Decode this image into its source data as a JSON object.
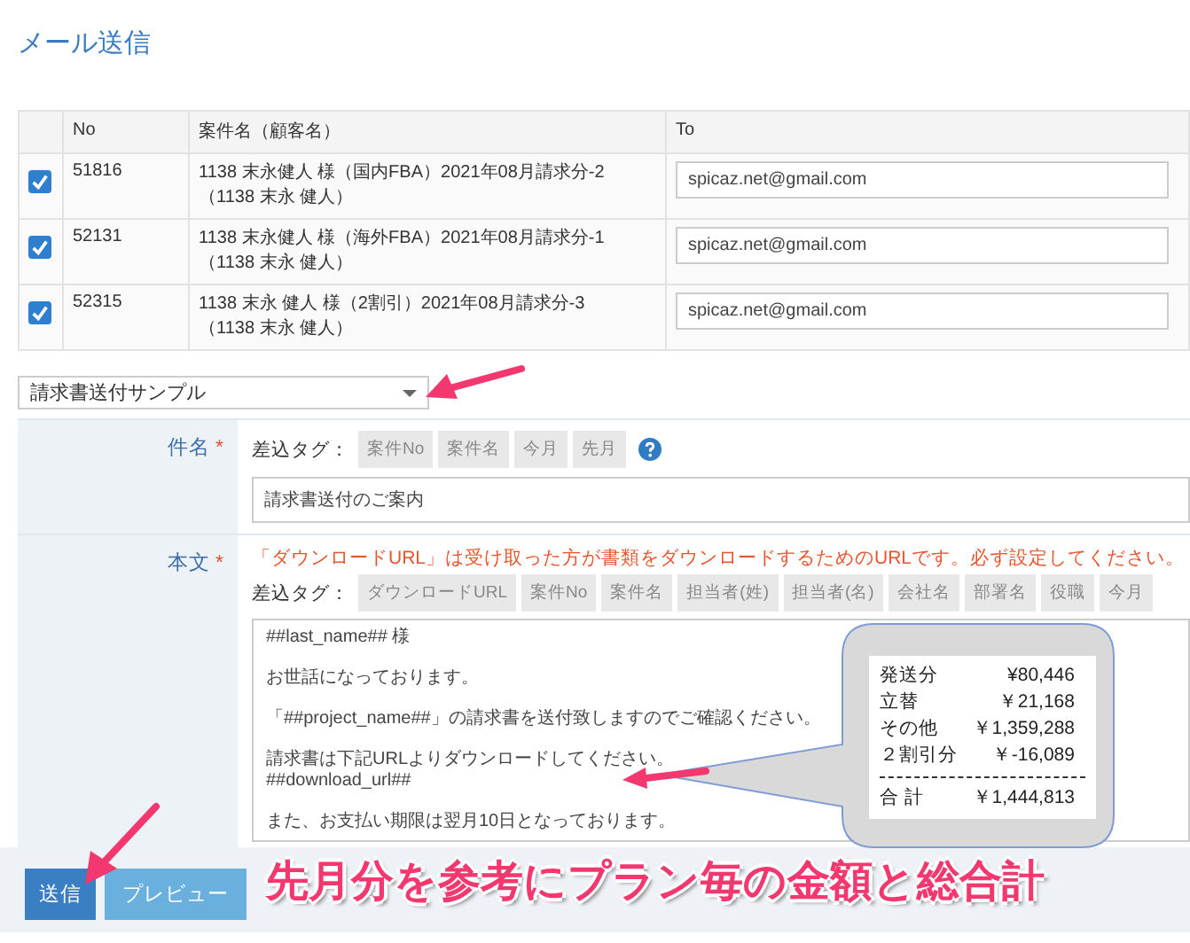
{
  "title": "メール送信",
  "table": {
    "columns": [
      "No",
      "案件名（顧客名）",
      "To"
    ],
    "rows": [
      {
        "checked": true,
        "no": "51816",
        "name": "1138 末永健人 様（国内FBA）2021年08月請求分-2",
        "customer": "（1138 末永 健人）",
        "to": "spicaz.net@gmail.com"
      },
      {
        "checked": true,
        "no": "52131",
        "name": "1138 末永健人 様（海外FBA）2021年08月請求分-1",
        "customer": "（1138 末永 健人）",
        "to": "spicaz.net@gmail.com"
      },
      {
        "checked": true,
        "no": "52315",
        "name": "1138 末永 健人 様（2割引）2021年08月請求分-3",
        "customer": "（1138 末永 健人）",
        "to": "spicaz.net@gmail.com"
      }
    ]
  },
  "template_select": {
    "value": "請求書送付サンプル"
  },
  "subject": {
    "label": "件名",
    "required_mark": "*",
    "tag_label": "差込タグ：",
    "tags": [
      "案件No",
      "案件名",
      "今月",
      "先月"
    ],
    "value": "請求書送付のご案内"
  },
  "body": {
    "label": "本文",
    "required_mark": "*",
    "notice": "「ダウンロードURL」は受け取った方が書類をダウンロードするためのURLです。必ず設定してください。",
    "tag_label": "差込タグ：",
    "tags": [
      "ダウンロードURL",
      "案件No",
      "案件名",
      "担当者(姓)",
      "担当者(名)",
      "会社名",
      "部署名",
      "役職",
      "今月"
    ],
    "paragraphs": [
      [
        "##last_name## 様"
      ],
      [
        "お世話になっております。"
      ],
      [
        "「##project_name##」の請求書を送付致しますのでご確認ください。"
      ],
      [
        "請求書は下記URLよりダウンロードしてください。",
        "##download_url##"
      ],
      [
        "また、お支払い期限は翌月10日となっております。"
      ]
    ]
  },
  "buttons": [
    {
      "label": "送信",
      "kind": "primary"
    },
    {
      "label": "プレビュー",
      "kind": "secondary"
    }
  ],
  "annotation": {
    "receipt": [
      {
        "label": "発送分",
        "amount": "¥80,446"
      },
      {
        "label": "立替",
        "amount": "￥21,168"
      },
      {
        "label": "その他",
        "amount": "￥1,359,288"
      },
      {
        "label": "２割引分",
        "amount": "￥-16,089"
      }
    ],
    "total": {
      "label": "合 計",
      "amount": "￥1,444,813"
    },
    "caption": "先月分を参考にプラン毎の金額と総合計"
  }
}
